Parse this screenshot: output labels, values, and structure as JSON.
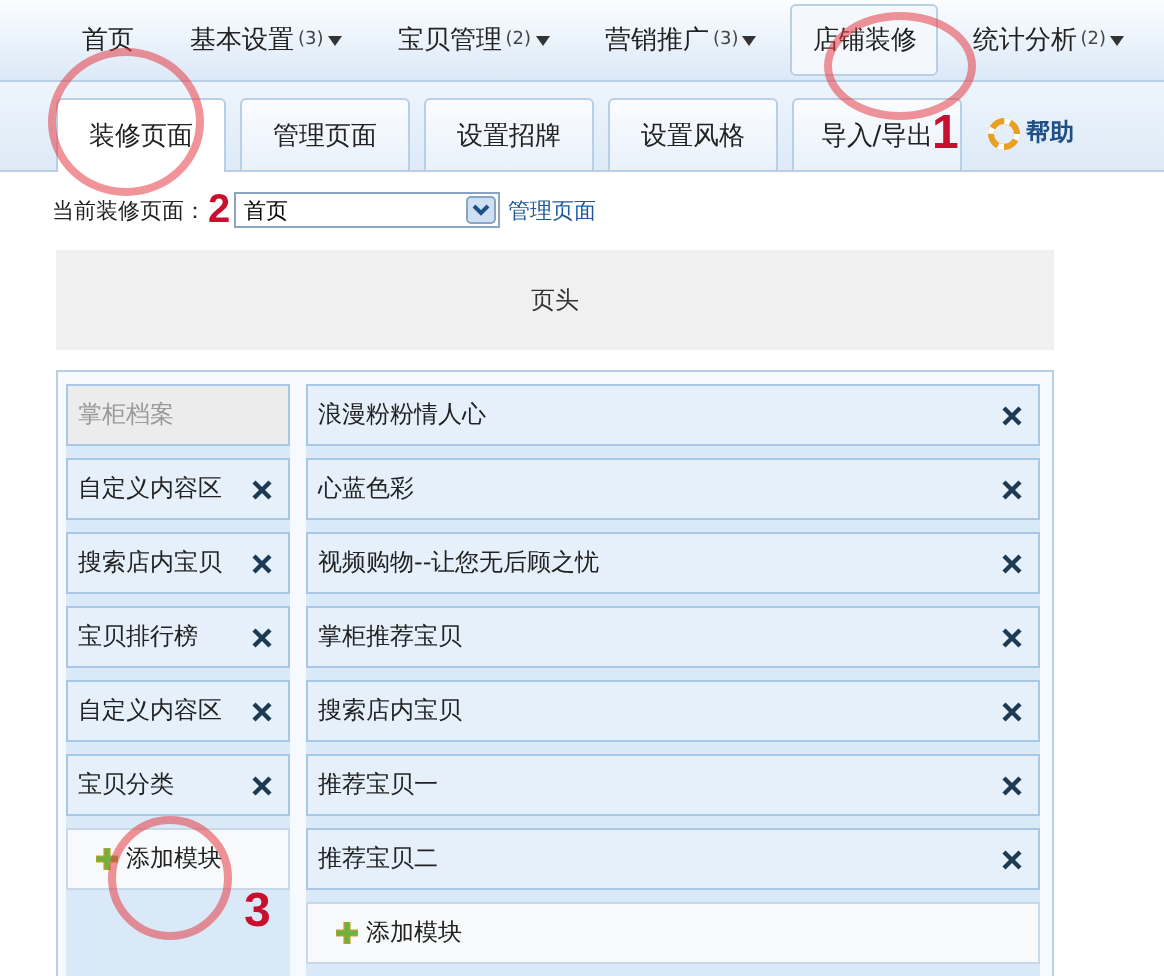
{
  "top_nav": [
    {
      "label": "首页",
      "dropdown": false,
      "selected": false
    },
    {
      "label": "基本设置",
      "count": "(3)",
      "dropdown": true,
      "selected": false
    },
    {
      "label": "宝贝管理",
      "count": "(2)",
      "dropdown": true,
      "selected": false
    },
    {
      "label": "营销推广",
      "count": "(3)",
      "dropdown": true,
      "selected": false
    },
    {
      "label": "店铺装修",
      "dropdown": false,
      "selected": true
    },
    {
      "label": "统计分析",
      "count": "(2)",
      "dropdown": true,
      "selected": false
    }
  ],
  "sub_tabs": [
    {
      "label": "装修页面",
      "selected": true
    },
    {
      "label": "管理页面",
      "selected": false
    },
    {
      "label": "设置招牌",
      "selected": false
    },
    {
      "label": "设置风格",
      "selected": false
    },
    {
      "label": "导入/导出",
      "selected": false
    }
  ],
  "help": "帮助",
  "page_select": {
    "label": "当前装修页面：",
    "value": "首页",
    "link": "管理页面"
  },
  "header_region": "页头",
  "left_modules": [
    {
      "label": "掌柜档案",
      "disabled": true
    },
    {
      "label": "自定义内容区",
      "disabled": false
    },
    {
      "label": "搜索店内宝贝",
      "disabled": false
    },
    {
      "label": "宝贝排行榜",
      "disabled": false
    },
    {
      "label": "自定义内容区",
      "disabled": false
    },
    {
      "label": "宝贝分类",
      "disabled": false
    }
  ],
  "left_add": "添加模块",
  "right_modules": [
    {
      "label": "浪漫粉粉情人心",
      "disabled": false
    },
    {
      "label": "心蓝色彩",
      "disabled": false
    },
    {
      "label": "视频购物--让您无后顾之忧",
      "disabled": false
    },
    {
      "label": "掌柜推荐宝贝",
      "disabled": false
    },
    {
      "label": "搜索店内宝贝",
      "disabled": false
    },
    {
      "label": "推荐宝贝一",
      "disabled": false
    },
    {
      "label": "推荐宝贝二",
      "disabled": false
    }
  ],
  "right_add": "添加模块",
  "annotations": [
    "1",
    "2",
    "3"
  ]
}
